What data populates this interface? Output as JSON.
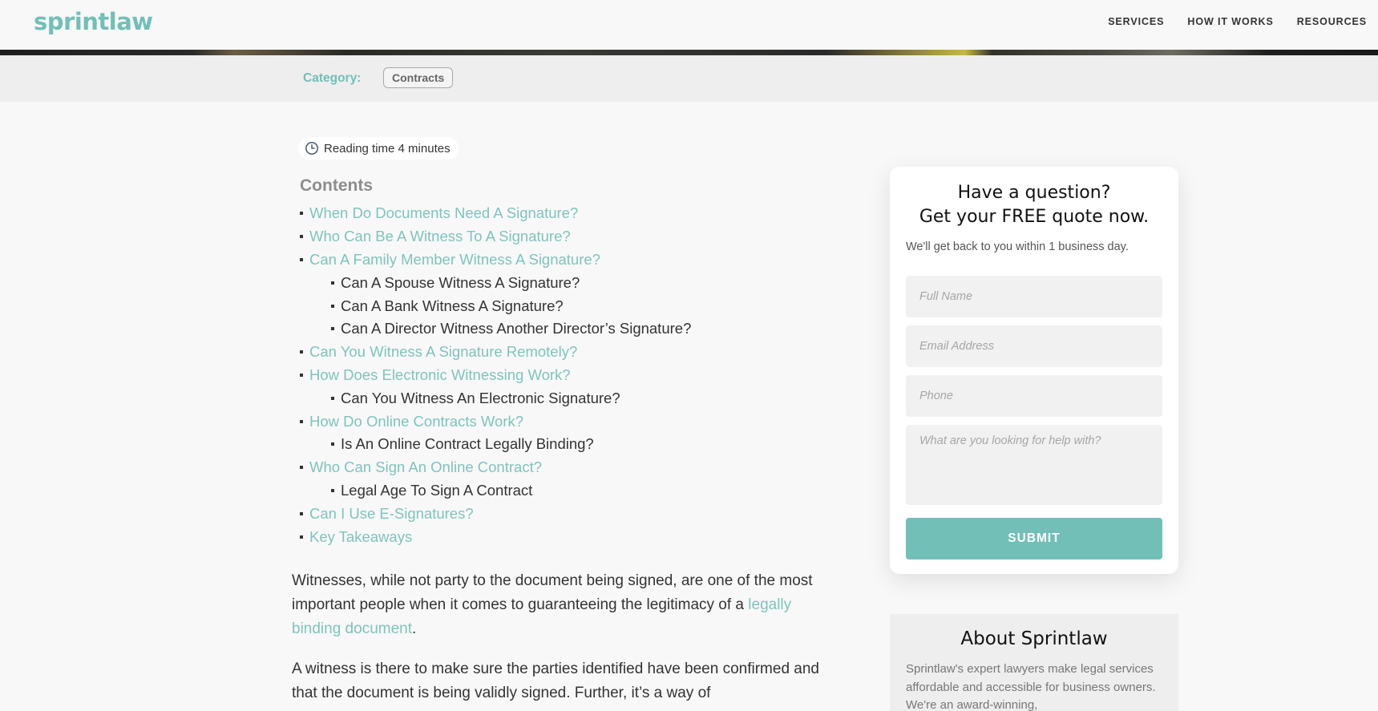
{
  "header": {
    "logo": "sprintlaw",
    "nav": [
      "SERVICES",
      "HOW IT WORKS",
      "RESOURCES"
    ]
  },
  "category": {
    "label": "Category:",
    "value": "Contracts"
  },
  "reading_time": "Reading time 4 minutes",
  "contents": {
    "title": "Contents",
    "items": [
      {
        "text": "When Do Documents Need A Signature?",
        "level": 1
      },
      {
        "text": "Who Can Be A Witness To A Signature?",
        "level": 1
      },
      {
        "text": "Can A Family Member Witness A Signature?",
        "level": 1
      },
      {
        "text": "Can A Spouse Witness A Signature?",
        "level": 2
      },
      {
        "text": "Can A Bank Witness A Signature?",
        "level": 2
      },
      {
        "text": "Can A Director Witness Another Director’s Signature?",
        "level": 2
      },
      {
        "text": "Can You Witness A Signature Remotely?",
        "level": 1
      },
      {
        "text": "How Does Electronic Witnessing Work?",
        "level": 1
      },
      {
        "text": "Can You Witness An Electronic Signature?",
        "level": 2
      },
      {
        "text": "How Do Online Contracts Work?",
        "level": 1
      },
      {
        "text": "Is An Online Contract Legally Binding?",
        "level": 2
      },
      {
        "text": "Who Can Sign An Online Contract?",
        "level": 1
      },
      {
        "text": "Legal Age To Sign A Contract",
        "level": 2
      },
      {
        "text": "Can I Use E-Signatures?",
        "level": 1
      },
      {
        "text": "Key Takeaways",
        "level": 1
      }
    ]
  },
  "article": {
    "p1_before": "Witnesses, while not party to the document being signed, are one of the most important people when it comes to guaranteeing the legitimacy of a ",
    "p1_link": "legally binding document",
    "p1_after": ".",
    "p2": "A witness is there to make sure the parties identified have been confirmed and that the document is being validly signed. Further, it’s a way of"
  },
  "quote_form": {
    "title_line1": "Have a question?",
    "title_line2": "Get your FREE quote now.",
    "subtitle": "We'll get back to you within 1 business day.",
    "full_name_placeholder": "Full Name",
    "email_placeholder": "Email Address",
    "phone_placeholder": "Phone",
    "help_placeholder": "What are you looking for help with?",
    "submit_label": "SUBMIT"
  },
  "about": {
    "title": "About Sprintlaw",
    "text": "Sprintlaw's expert lawyers make legal services affordable and accessible for business owners. We're an award-winning,"
  },
  "colors": {
    "accent": "#72bfb8",
    "link": "#7ec4bd"
  }
}
